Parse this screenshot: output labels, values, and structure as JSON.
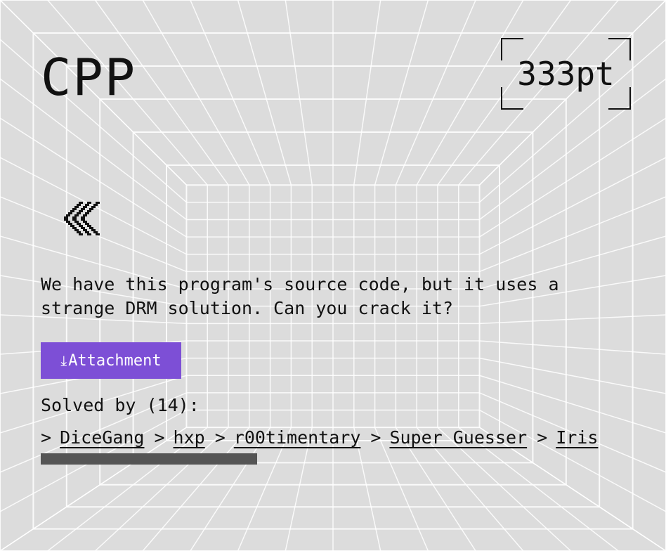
{
  "challenge": {
    "title": "CPP",
    "points": "333pt",
    "description": "We have this program's source code, but it uses a\nstrange DRM solution. Can you crack it?",
    "attachment_label": "Attachment",
    "attachment_icon": "download-icon",
    "back_icon": "chevron-double-left-icon"
  },
  "solved": {
    "label": "Solved by (14):",
    "count": 14,
    "teams": [
      {
        "name": "DiceGang"
      },
      {
        "name": "hxp"
      },
      {
        "name": "r00timentary"
      },
      {
        "name": "Super Guesser"
      },
      {
        "name": "Iris"
      }
    ],
    "separator": ">",
    "scroll_position": 0.0
  },
  "colors": {
    "background": "#dcdcdc",
    "accent": "#7d4fd6",
    "text": "#111111",
    "scrollbar_thumb": "#555555"
  }
}
